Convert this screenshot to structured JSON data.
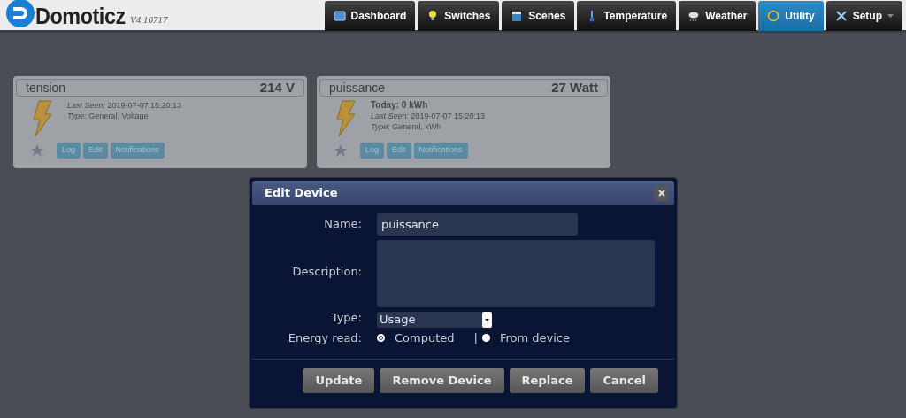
{
  "header": {
    "logo": "Domoticz",
    "version": "V4.10717"
  },
  "nav": [
    {
      "label": "Dashboard",
      "kind": "dashboard",
      "selected": false
    },
    {
      "label": "Switches",
      "kind": "bulb",
      "selected": false
    },
    {
      "label": "Scenes",
      "kind": "scenes",
      "selected": false
    },
    {
      "label": "Temperature",
      "kind": "thermo",
      "selected": false
    },
    {
      "label": "Weather",
      "kind": "weather",
      "selected": false
    },
    {
      "label": "Utility",
      "kind": "utility",
      "selected": true
    },
    {
      "label": "Setup",
      "kind": "setup",
      "selected": false,
      "dropdown": true
    }
  ],
  "devices": [
    {
      "name": "tension",
      "value": "214 V",
      "details": [
        {
          "label": "Last Seen:",
          "value": "2019-07-07 15:20:13"
        },
        {
          "label": "Type:",
          "value": "General, Voltage"
        }
      ],
      "buttons": [
        "Log",
        "Edit",
        "Notifications"
      ]
    },
    {
      "name": "puissance",
      "value": "27 Watt",
      "today": "Today: 0 kWh",
      "details": [
        {
          "label": "Last Seen:",
          "value": "2019-07-07 15:20:13"
        },
        {
          "label": "Type:",
          "value": "General, kWh"
        }
      ],
      "buttons": [
        "Log",
        "Edit",
        "Notifications"
      ]
    }
  ],
  "dialog": {
    "title": "Edit Device",
    "name_label": "Name:",
    "name_value": "puissance",
    "description_label": "Description:",
    "type_label": "Type:",
    "type_value": "Usage",
    "energy_label": "Energy read:",
    "energy_options": [
      {
        "label": "Computed",
        "selected": true
      },
      {
        "label": "From device",
        "selected": false
      }
    ],
    "separator": "|",
    "buttons": [
      "Update",
      "Remove Device",
      "Replace",
      "Cancel"
    ]
  }
}
